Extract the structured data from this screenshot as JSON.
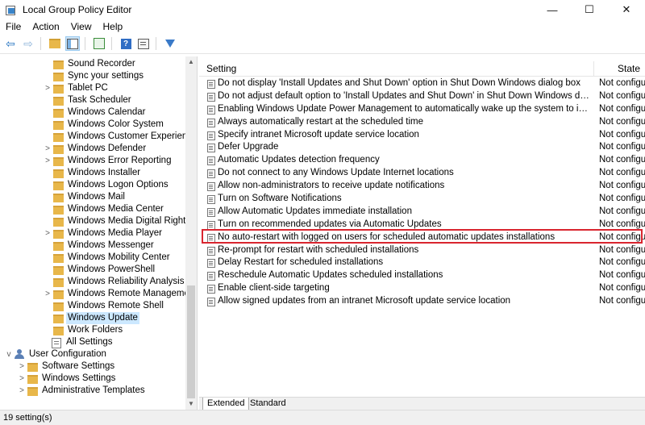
{
  "window": {
    "title": "Local Group Policy Editor",
    "minimize": "—",
    "maximize": "☐",
    "close": "✕"
  },
  "menu": [
    "File",
    "Action",
    "View",
    "Help"
  ],
  "toolbar": {
    "back_icon": "back-arrow-icon",
    "forward_icon": "forward-arrow-icon",
    "help_label": "?"
  },
  "tree": {
    "items": [
      {
        "label": "Sound Recorder",
        "level": 3,
        "expander": ""
      },
      {
        "label": "Sync your settings",
        "level": 3,
        "expander": ""
      },
      {
        "label": "Tablet PC",
        "level": 3,
        "expander": ">"
      },
      {
        "label": "Task Scheduler",
        "level": 3,
        "expander": ""
      },
      {
        "label": "Windows Calendar",
        "level": 3,
        "expander": ""
      },
      {
        "label": "Windows Color System",
        "level": 3,
        "expander": ""
      },
      {
        "label": "Windows Customer Experience Ir",
        "level": 3,
        "expander": ""
      },
      {
        "label": "Windows Defender",
        "level": 3,
        "expander": ">"
      },
      {
        "label": "Windows Error Reporting",
        "level": 3,
        "expander": ">"
      },
      {
        "label": "Windows Installer",
        "level": 3,
        "expander": ""
      },
      {
        "label": "Windows Logon Options",
        "level": 3,
        "expander": ""
      },
      {
        "label": "Windows Mail",
        "level": 3,
        "expander": ""
      },
      {
        "label": "Windows Media Center",
        "level": 3,
        "expander": ""
      },
      {
        "label": "Windows Media Digital Rights M",
        "level": 3,
        "expander": ""
      },
      {
        "label": "Windows Media Player",
        "level": 3,
        "expander": ">"
      },
      {
        "label": "Windows Messenger",
        "level": 3,
        "expander": ""
      },
      {
        "label": "Windows Mobility Center",
        "level": 3,
        "expander": ""
      },
      {
        "label": "Windows PowerShell",
        "level": 3,
        "expander": ""
      },
      {
        "label": "Windows Reliability Analysis",
        "level": 3,
        "expander": ""
      },
      {
        "label": "Windows Remote Management",
        "level": 3,
        "expander": ">"
      },
      {
        "label": "Windows Remote Shell",
        "level": 3,
        "expander": ""
      },
      {
        "label": "Windows Update",
        "level": 3,
        "expander": "",
        "selected": true
      },
      {
        "label": "Work Folders",
        "level": 3,
        "expander": ""
      },
      {
        "label": "All Settings",
        "level": 2,
        "expander": "",
        "icon": "settings"
      },
      {
        "label": "User Configuration",
        "level": 0,
        "expander": "v",
        "icon": "user"
      },
      {
        "label": "Software Settings",
        "level": 1,
        "expander": ">"
      },
      {
        "label": "Windows Settings",
        "level": 1,
        "expander": ">"
      },
      {
        "label": "Administrative Templates",
        "level": 1,
        "expander": ">"
      }
    ]
  },
  "list": {
    "col_setting": "Setting",
    "col_state": "State",
    "rows": [
      {
        "name": "Do not display 'Install Updates and Shut Down' option in Shut Down Windows dialog box",
        "state": "Not configu"
      },
      {
        "name": "Do not adjust default option to 'Install Updates and Shut Down' in Shut Down Windows dialog box",
        "state": "Not configu"
      },
      {
        "name": "Enabling Windows Update Power Management to automatically wake up the system to install schedule...",
        "state": "Not configu"
      },
      {
        "name": "Always automatically restart at the scheduled time",
        "state": "Not configu"
      },
      {
        "name": "Specify intranet Microsoft update service location",
        "state": "Not configu"
      },
      {
        "name": "Defer Upgrade",
        "state": "Not configu"
      },
      {
        "name": "Automatic Updates detection frequency",
        "state": "Not configu"
      },
      {
        "name": "Do not connect to any Windows Update Internet locations",
        "state": "Not configu"
      },
      {
        "name": "Allow non-administrators to receive update notifications",
        "state": "Not configu"
      },
      {
        "name": "Turn on Software Notifications",
        "state": "Not configu"
      },
      {
        "name": "Allow Automatic Updates immediate installation",
        "state": "Not configu"
      },
      {
        "name": "Turn on recommended updates via Automatic Updates",
        "state": "Not configu"
      },
      {
        "name": "No auto-restart with logged on users for scheduled automatic updates installations",
        "state": "Not configu",
        "highlighted": true
      },
      {
        "name": "Re-prompt for restart with scheduled installations",
        "state": "Not configu"
      },
      {
        "name": "Delay Restart for scheduled installations",
        "state": "Not configu"
      },
      {
        "name": "Reschedule Automatic Updates scheduled installations",
        "state": "Not configu"
      },
      {
        "name": "Enable client-side targeting",
        "state": "Not configu"
      },
      {
        "name": "Allow signed updates from an intranet Microsoft update service location",
        "state": "Not configu"
      }
    ]
  },
  "tabs": [
    "Extended",
    "Standard"
  ],
  "status": "19 setting(s)",
  "colors": {
    "highlight_border": "#d9252f",
    "selection": "#cce8ff",
    "folder": "#e8b74a"
  }
}
